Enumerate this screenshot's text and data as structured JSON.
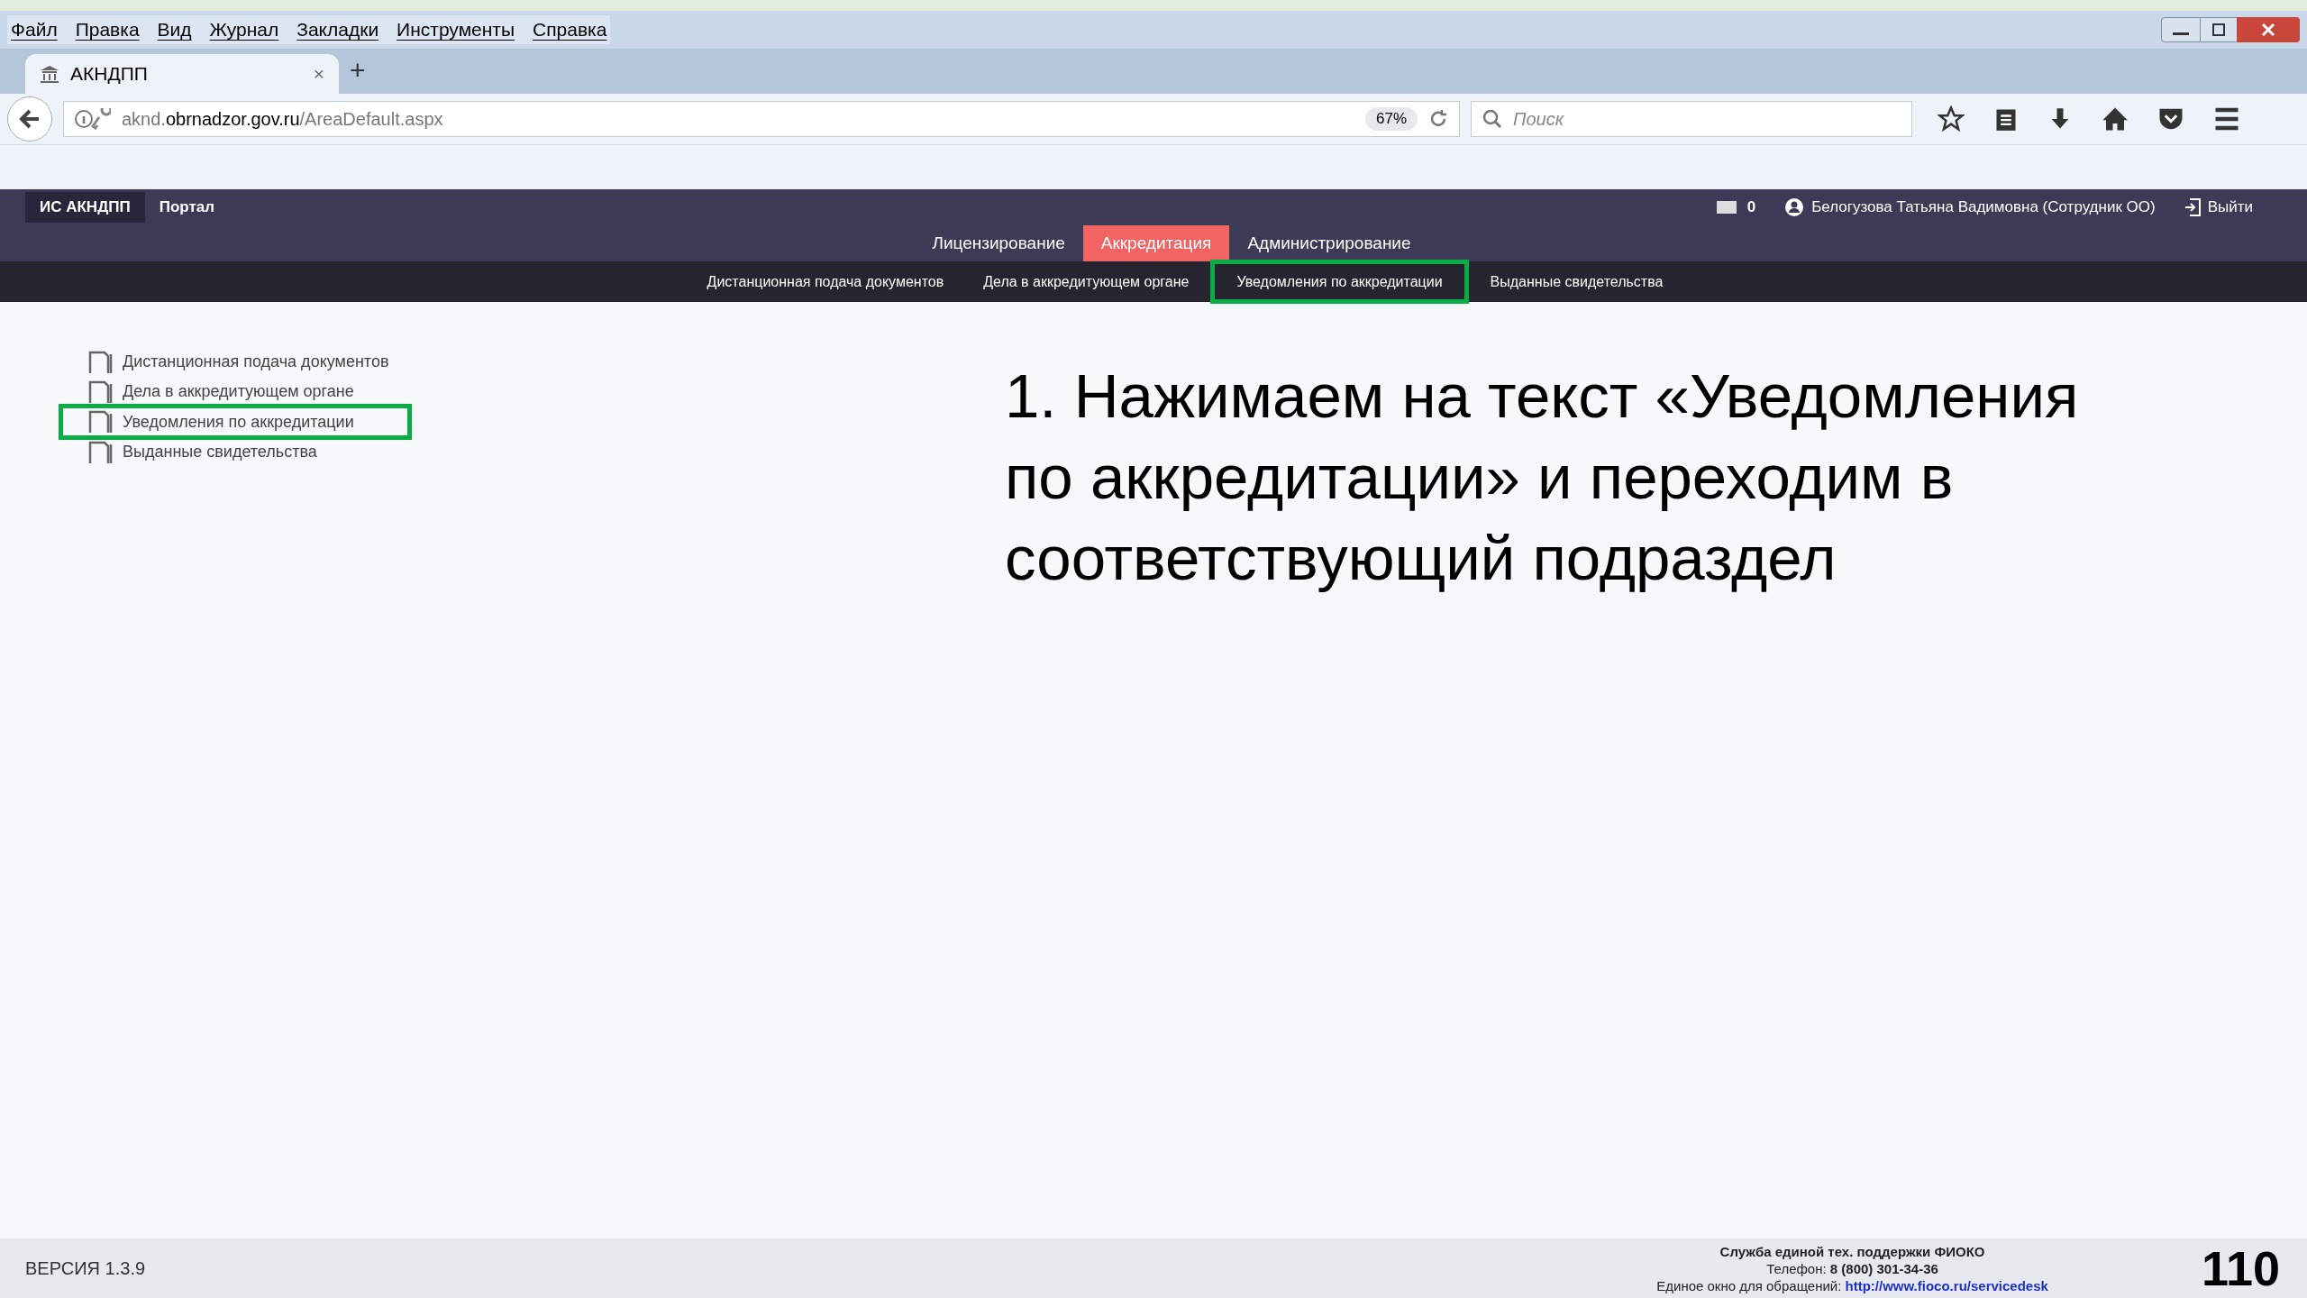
{
  "menu_bar": [
    "Файл",
    "Правка",
    "Вид",
    "Журнал",
    "Закладки",
    "Инструменты",
    "Справка"
  ],
  "tab": {
    "title": "АКНДПП",
    "close": "×",
    "new_tab": "+"
  },
  "address_bar": {
    "host_prefix": "aknd.",
    "host": "obrnadzor.gov.ru",
    "path": "/AreaDefault.aspx",
    "zoom": "67%"
  },
  "search": {
    "placeholder": "Поиск"
  },
  "site_header": {
    "brand": "ИС АКНДПП",
    "portal": "Портал",
    "messages": "0",
    "user": "Белогузова Татьяна Вадимовна (Сотрудник ОО)",
    "logout": "Выйти"
  },
  "main_nav": [
    {
      "label": "Лицензирование",
      "selected": false
    },
    {
      "label": "Аккредитация",
      "selected": true
    },
    {
      "label": "Администрирование",
      "selected": false
    }
  ],
  "sub_nav": [
    {
      "label": "Дистанционная подача документов",
      "highlighted": false
    },
    {
      "label": "Дела в аккредитующем органе",
      "highlighted": false
    },
    {
      "label": "Уведомления по аккредитации",
      "highlighted": true
    },
    {
      "label": "Выданные свидетельства",
      "highlighted": false
    }
  ],
  "tree": [
    {
      "label": "Дистанционная подача документов",
      "highlighted": false
    },
    {
      "label": "Дела в аккредитующем органе",
      "highlighted": false
    },
    {
      "label": "Уведомления по аккредитации",
      "highlighted": true
    },
    {
      "label": "Выданные свидетельства",
      "highlighted": false
    }
  ],
  "instruction": "1. Нажимаем на текст «Уведомления по аккредитации» и переходим в соответствующий подраздел",
  "footer": {
    "version": "ВЕРСИЯ 1.3.9",
    "support_title": "Служба единой тех. поддержки ФИОКО",
    "phone_label": "Телефон:",
    "phone": "8 (800) 301-34-36",
    "window_label": "Единое окно для обращений:",
    "window_link": "http://www.fioco.ru/servicedesk"
  },
  "page_number": "110"
}
